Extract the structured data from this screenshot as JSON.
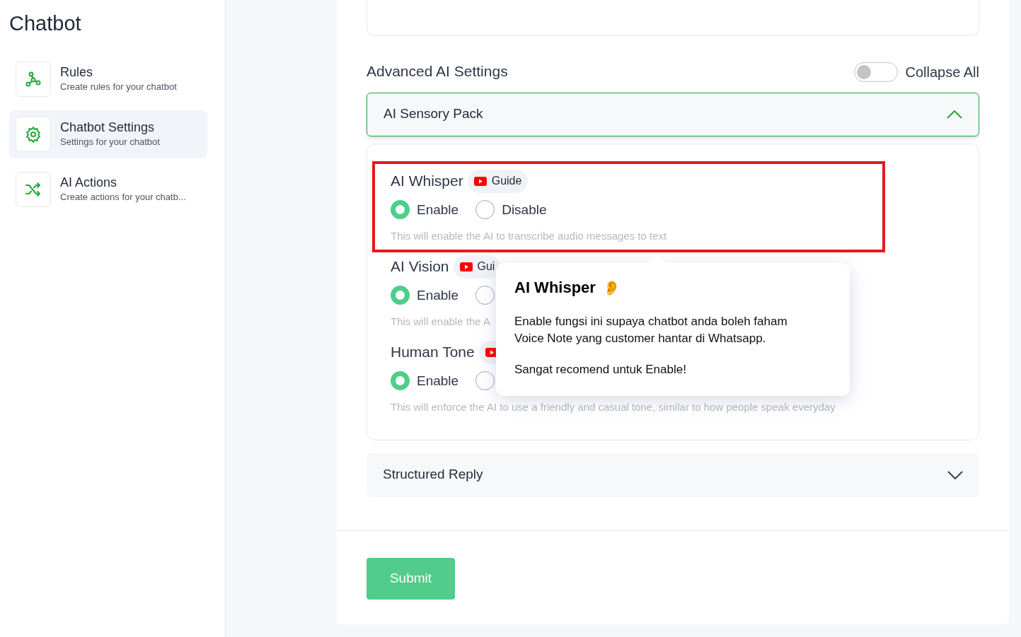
{
  "sidebar": {
    "title": "Chatbot",
    "items": [
      {
        "kind": "nodes",
        "label": "Rules",
        "description": "Create rules for your chatbot",
        "selected": false
      },
      {
        "kind": "gear",
        "label": "Chatbot Settings",
        "description": "Settings for your chatbot",
        "selected": true
      },
      {
        "kind": "shuffle",
        "label": "AI Actions",
        "description": "Create actions for your chatb...",
        "selected": false
      }
    ]
  },
  "section": {
    "title": "Advanced AI Settings",
    "collapse_all": {
      "label": "Collapse All",
      "on": false
    }
  },
  "accordions": [
    {
      "title": "AI Sensory Pack",
      "expanded": true,
      "settings": [
        {
          "title": "AI Whisper",
          "guide": "Guide",
          "options": [
            {
              "label": "Enable",
              "selected": true
            },
            {
              "label": "Disable",
              "selected": false
            }
          ],
          "description": "This will enable the AI to transcribe audio messages to text",
          "highlighted": true
        },
        {
          "title": "AI Vision",
          "guide": "Gui",
          "options": [
            {
              "label": "Enable",
              "selected": true
            },
            {
              "selected": false
            }
          ],
          "description": "This will enable the A",
          "highlighted": false
        },
        {
          "title": "Human Tone",
          "options": [
            {
              "label": "Enable",
              "selected": true
            },
            {
              "selected": false
            }
          ],
          "description": "This will enforce the AI to use a friendly and casual tone, similar to how people speak everyday",
          "highlighted": false
        }
      ]
    },
    {
      "title": "Structured Reply",
      "expanded": false
    }
  ],
  "tooltip": {
    "title": "AI Whisper",
    "emoji": "👂",
    "lines": [
      "Enable fungsi ini supaya chatbot anda boleh faham Voice Note yang customer hantar di Whatsapp.",
      "Sangat recomend untuk Enable!"
    ]
  },
  "submit": "Submit"
}
